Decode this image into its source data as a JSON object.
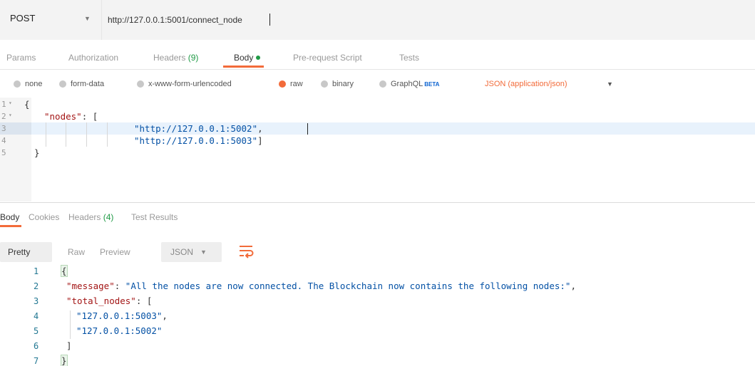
{
  "request": {
    "method": "POST",
    "url": "http://127.0.0.1:5001/connect_node"
  },
  "request_tabs": [
    {
      "label": "Params"
    },
    {
      "label": "Authorization"
    },
    {
      "label": "Headers",
      "count": "(9)"
    },
    {
      "label": "Body",
      "active": true
    },
    {
      "label": "Pre-request Script"
    },
    {
      "label": "Tests"
    }
  ],
  "body_options": {
    "none": "none",
    "form_data": "form-data",
    "urlencoded": "x-www-form-urlencoded",
    "raw": "raw",
    "binary": "binary",
    "graphql": "GraphQL",
    "beta": "BETA",
    "content_type": "JSON (application/json)",
    "selected": "raw"
  },
  "request_body": {
    "line_numbers": [
      "1",
      "2",
      "3",
      "4",
      "5"
    ],
    "fold_markers": [
      "▾",
      "▾"
    ],
    "open_brace": "{",
    "key": "\"nodes\"",
    "colon": ": [",
    "value_1": "\"http://127.0.0.1:5002\"",
    "comma": ",",
    "value_2": "\"http://127.0.0.1:5003\"",
    "close_bracket": "]",
    "close_brace": "}"
  },
  "response_tabs": [
    {
      "label": "Body",
      "active": true
    },
    {
      "label": "Cookies"
    },
    {
      "label": "Headers",
      "count": "(4)"
    },
    {
      "label": "Test Results"
    }
  ],
  "response_view": {
    "pretty": "Pretty",
    "raw": "Raw",
    "preview": "Preview",
    "format": "JSON",
    "wrap_icon": "wrap-lines-icon"
  },
  "response_body": {
    "line_numbers": [
      "1",
      "2",
      "3",
      "4",
      "5",
      "6",
      "7"
    ],
    "open_brace": "{",
    "message_key": "\"message\"",
    "message_value": "\"All the nodes are now connected. The Blockchain now contains the following nodes:\"",
    "total_key": "\"total_nodes\"",
    "total_open": ": [",
    "node_1": "\"127.0.0.1:5003\"",
    "node_2": "\"127.0.0.1:5002\"",
    "close_bracket": "]",
    "close_brace": "}"
  },
  "colors": {
    "accent": "#f26b3a",
    "count_green": "#1f9a45",
    "json_key": "#a31515",
    "json_string": "#0451a5"
  }
}
